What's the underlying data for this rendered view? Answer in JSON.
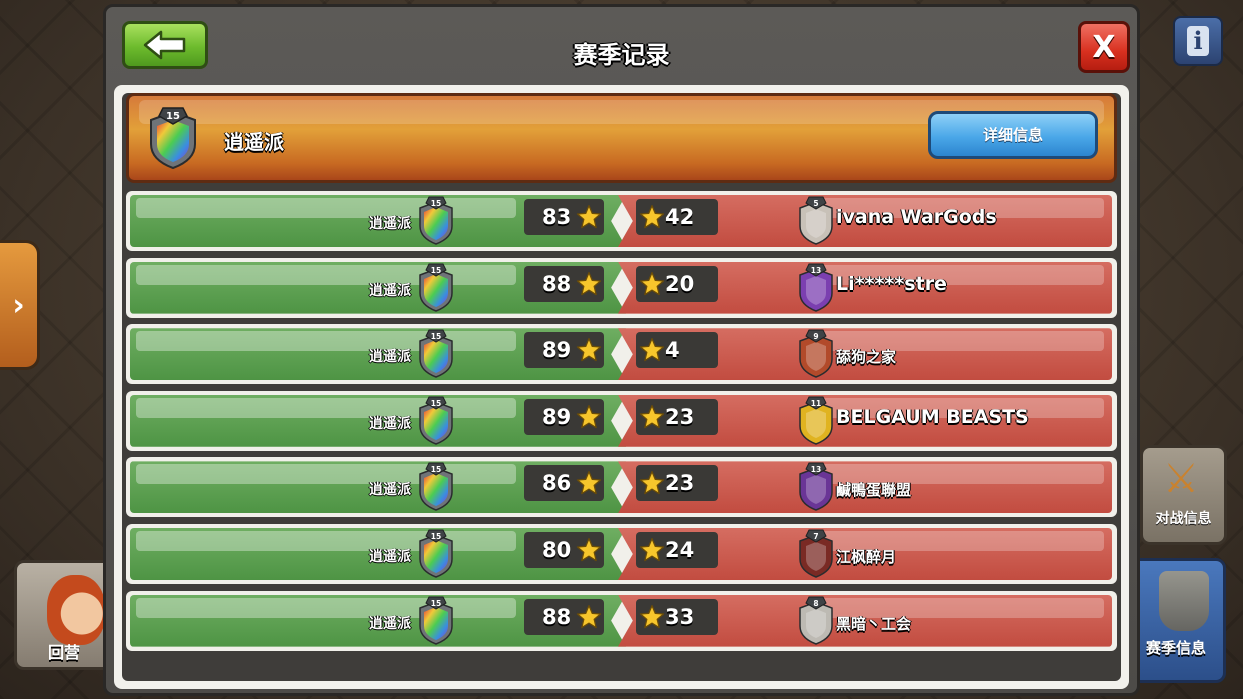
{
  "window": {
    "title": "赛季记录",
    "close_label": "X"
  },
  "side": {
    "home_label": "回营",
    "war_info_label": "对战信息",
    "season_info_label": "赛季信息",
    "info_label": "i",
    "expand_label": "›"
  },
  "clan": {
    "name": "逍遥派",
    "level": "15",
    "detail_button": "详细信息"
  },
  "wars": [
    {
      "own_name": "逍遥派",
      "own_level": "15",
      "own_stars": "83",
      "opp_stars": "42",
      "opp_level": "5",
      "opp_name": "ivana WarGods",
      "opp_badge_color": "#c8c1b8"
    },
    {
      "own_name": "逍遥派",
      "own_level": "15",
      "own_stars": "88",
      "opp_stars": "20",
      "opp_level": "13",
      "opp_name": "Li*****stre",
      "opp_badge_color": "#7b3fb0"
    },
    {
      "own_name": "逍遥派",
      "own_level": "15",
      "own_stars": "89",
      "opp_stars": "4",
      "opp_level": "9",
      "opp_name": "舔狗之家",
      "opp_badge_color": "#b24a2a"
    },
    {
      "own_name": "逍遥派",
      "own_level": "15",
      "own_stars": "89",
      "opp_stars": "23",
      "opp_level": "11",
      "opp_name": "BELGAUM BEASTS",
      "opp_badge_color": "#e0b320"
    },
    {
      "own_name": "逍遥派",
      "own_level": "15",
      "own_stars": "86",
      "opp_stars": "23",
      "opp_level": "13",
      "opp_name": "鹹鴨蛋聯盟",
      "opp_badge_color": "#6a3596"
    },
    {
      "own_name": "逍遥派",
      "own_level": "15",
      "own_stars": "80",
      "opp_stars": "24",
      "opp_level": "7",
      "opp_name": "江枫醉月",
      "opp_badge_color": "#7a2a24"
    },
    {
      "own_name": "逍遥派",
      "own_level": "15",
      "own_stars": "88",
      "opp_stars": "33",
      "opp_level": "8",
      "opp_name": "黑暗丶工会",
      "opp_badge_color": "#bdbab3"
    }
  ],
  "colors": {
    "win_green": "#4e9444",
    "loss_red": "#c24c40",
    "header_orange": "#e2a039",
    "button_blue": "#4aa7e8",
    "back_green": "#6dbb2d",
    "close_red": "#d8301f"
  },
  "icons": {
    "back": "arrow-left-icon",
    "close": "close-icon",
    "star": "star-icon",
    "clan_badge": "clan-badge-icon",
    "info": "info-icon",
    "swords": "crossed-swords-icon",
    "trophy": "trophy-icon"
  }
}
